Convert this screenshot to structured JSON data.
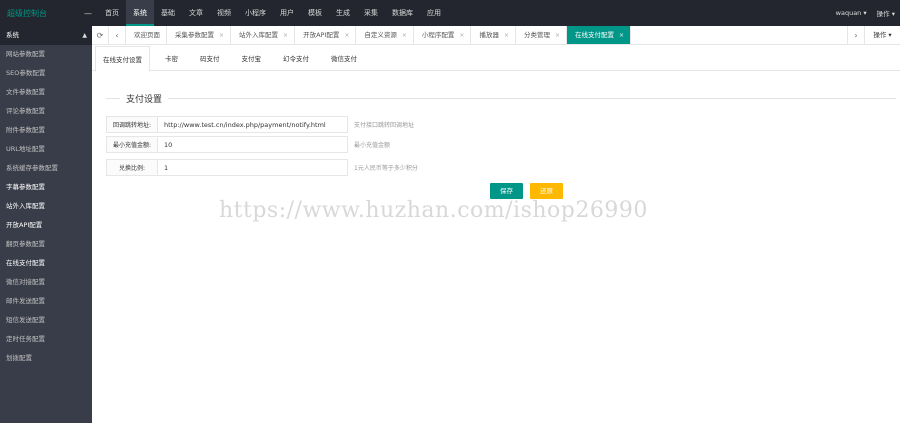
{
  "header": {
    "brand": "超级控制台",
    "menu_toggle": "—",
    "nav": [
      "首页",
      "系统",
      "基础",
      "文章",
      "视频",
      "小程序",
      "用户",
      "模板",
      "生成",
      "采集",
      "数据库",
      "应用"
    ],
    "user": "waquan",
    "user_caret": "▾",
    "ops_label": "操作",
    "ops_caret": "▾"
  },
  "sidebar": {
    "title": "系统",
    "caret": "▲",
    "items": [
      "网站参数配置",
      "SEO参数配置",
      "文件参数配置",
      "评论参数配置",
      "附件参数配置",
      "URL地址配置",
      "系统缓存参数配置",
      "字幕参数配置",
      "站外入库配置",
      "开放API配置",
      "翻页参数配置",
      "在线支付配置",
      "微信对接配置",
      "邮件发送配置",
      "短信发送配置",
      "定时任务配置",
      "划拨配置"
    ]
  },
  "tabbar": {
    "refresh": "⟳",
    "prev": "‹",
    "next": "›",
    "close": "×",
    "tabs": [
      "欢迎页面",
      "采集参数配置",
      "站外入库配置",
      "开放API配置",
      "自定义资源",
      "小程序配置",
      "播放器",
      "分类管理",
      "在线支付配置"
    ],
    "ops": "操作 ▾"
  },
  "subtabs": [
    "在线支付设置",
    "卡密",
    "码支付",
    "支付宝",
    "幻令支付",
    "微信支付"
  ],
  "section": {
    "legend": "支付设置",
    "fields": [
      {
        "label": "回调跳转地址:",
        "value": "http://www.test.cn/index.php/payment/notify.html",
        "hint": "支付接口跳转回调地址"
      },
      {
        "label": "最小充值金额:",
        "value": "10",
        "hint": "最小充值金额"
      },
      {
        "label": "兑换比例:",
        "value": "1",
        "hint": "1元人民币等于多少积分"
      }
    ],
    "save": "保存",
    "reset": "还原"
  },
  "watermark": "https://www.huzhan.com/ishop26990",
  "colors": {
    "accent": "#009688",
    "warning": "#ffb800",
    "sidebar_bg": "#393d49",
    "topbar_bg": "#23262e"
  }
}
